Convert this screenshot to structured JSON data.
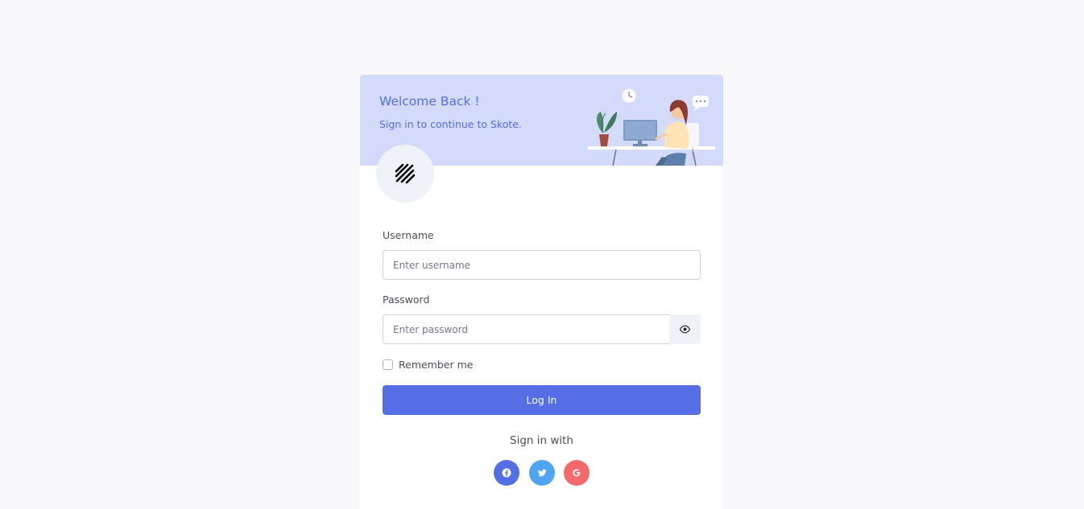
{
  "header": {
    "title": "Welcome Back !",
    "subtitle": "Sign in to continue to Skote."
  },
  "logo": {
    "icon": "stripes-logo-icon"
  },
  "form": {
    "username_label": "Username",
    "username_placeholder": "Enter username",
    "username_value": "",
    "password_label": "Password",
    "password_placeholder": "Enter password",
    "password_value": "",
    "password_toggle_icon": "eye-icon",
    "remember_label": "Remember me",
    "remember_checked": false,
    "login_label": "Log In"
  },
  "social": {
    "heading": "Sign in with",
    "items": [
      {
        "name": "facebook",
        "icon": "facebook-icon",
        "color": "#556ee6"
      },
      {
        "name": "twitter",
        "icon": "twitter-icon",
        "color": "#50a5f1"
      },
      {
        "name": "google",
        "icon": "google-icon",
        "color": "#f46a6a"
      }
    ]
  },
  "colors": {
    "primary": "#556ee6",
    "header_bg": "#d4daf9",
    "page_bg": "#f8f8fb"
  }
}
